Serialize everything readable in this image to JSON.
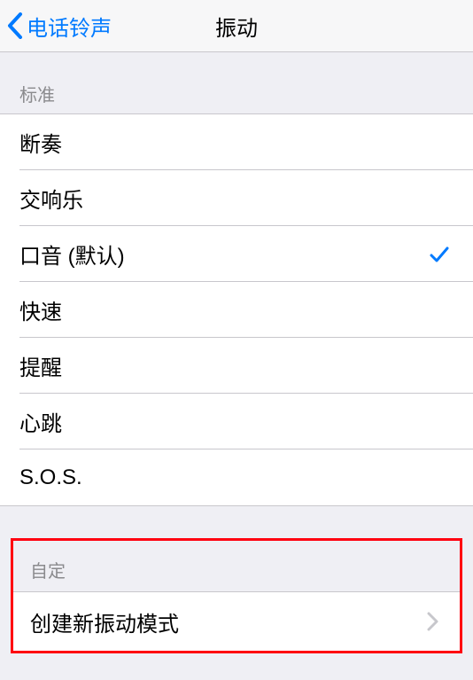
{
  "nav": {
    "back_label": "电话铃声",
    "title": "振动"
  },
  "sections": {
    "standard": {
      "header": "标准",
      "items": [
        {
          "label": "断奏",
          "selected": false
        },
        {
          "label": "交响乐",
          "selected": false
        },
        {
          "label": "口音 (默认)",
          "selected": true
        },
        {
          "label": "快速",
          "selected": false
        },
        {
          "label": "提醒",
          "selected": false
        },
        {
          "label": "心跳",
          "selected": false
        },
        {
          "label": "S.O.S.",
          "selected": false
        }
      ]
    },
    "custom": {
      "header": "自定",
      "create_label": "创建新振动模式"
    }
  },
  "colors": {
    "accent": "#007aff",
    "highlight_border": "#ff0010"
  }
}
